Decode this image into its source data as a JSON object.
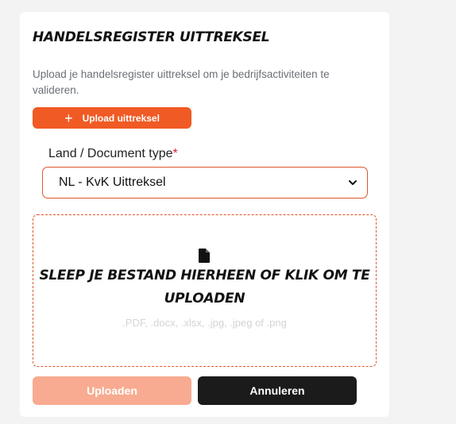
{
  "card": {
    "title": "HANDELSREGISTER UITTREKSEL",
    "description": "Upload je handelsregister uittreksel om je bedrijfsactiviteiten te valideren.",
    "upload_button": {
      "icon": "plus-icon",
      "label": "Upload uittreksel"
    },
    "country_field": {
      "label": "Land / Document type",
      "required_mark": "*",
      "selected_value": "NL - KvK Uittreksel"
    },
    "dropzone": {
      "icon": "file-icon",
      "title": "SLEEP JE BESTAND HIERHEEN OF KLIK OM TE UPLOADEN",
      "hint": ".PDF, .docx, .xlsx, .jpg, .jpeg of .png"
    },
    "actions": {
      "submit_label": "Uploaden",
      "cancel_label": "Annuleren"
    }
  },
  "colors": {
    "accent": "#f05a24",
    "accent_disabled": "#f8ab90",
    "dark": "#1b1b1b",
    "required": "#e2183d"
  }
}
